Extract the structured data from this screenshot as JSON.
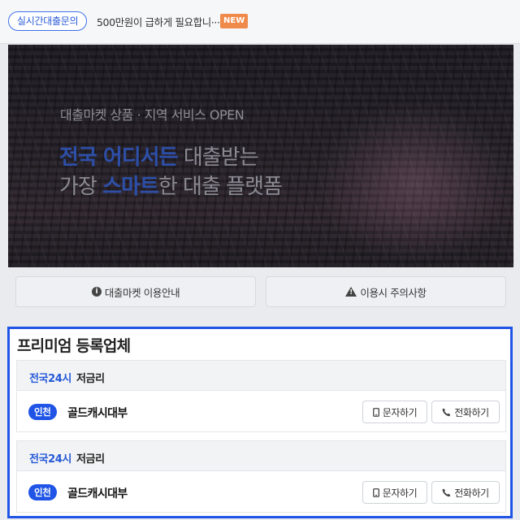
{
  "ticker": {
    "badge": "실시간대출문의",
    "text": "500만원이 급하게 필요합니···",
    "new_label": "NEW"
  },
  "banner": {
    "kicker": "대출마켓 상품 · 지역 서비스 OPEN",
    "line1_highlight": "전국 어디서든",
    "line1_rest": " 대출받는",
    "line2_pre": "가장 ",
    "line2_highlight": "스마트",
    "line2_rest": "한 대출 플랫폼"
  },
  "info_buttons": {
    "guide": "대출마켓 이용안내",
    "caution": "이용시 주의사항"
  },
  "premium": {
    "title": "프리미엄 등록업체",
    "cards": [
      {
        "region": "전국24시",
        "rate": "저금리",
        "city": "인천",
        "name": "골드캐시대부",
        "sms": "문자하기",
        "call": "전화하기"
      },
      {
        "region": "전국24시",
        "rate": "저금리",
        "city": "인천",
        "name": "골드캐시대부",
        "sms": "문자하기",
        "call": "전화하기"
      }
    ]
  },
  "colors": {
    "accent": "#1f54e6",
    "new_badge": "#f08a4b"
  }
}
